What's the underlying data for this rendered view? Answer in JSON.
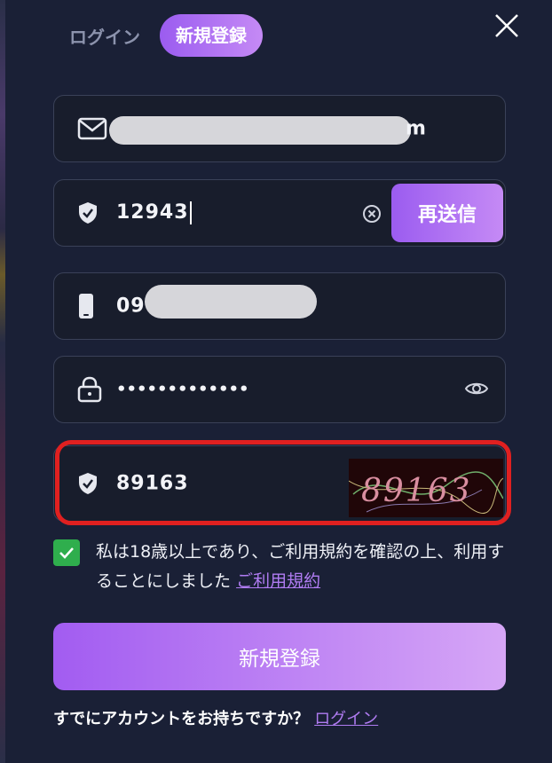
{
  "tabs": {
    "login": "ログイン",
    "register": "新規登録"
  },
  "fields": {
    "email": {
      "value_suffix": "m"
    },
    "code": {
      "value": "12943",
      "resend_label": "再送信"
    },
    "phone": {
      "value_prefix": "09"
    },
    "password": {
      "value": "•••••••••••••"
    },
    "captcha": {
      "value": "89163",
      "image_text": "89163"
    }
  },
  "agreement": {
    "checked": true,
    "text": "私は18歳以上であり、ご利用規約を確認の上、利用することにしました",
    "link": "ご利用規約"
  },
  "submit_label": "新規登録",
  "footer": {
    "question": "すでにアカウントをお持ちですか？",
    "login_link": "ログイン"
  },
  "colors": {
    "accent": "#9b5cf0",
    "highlight": "#e02020",
    "check": "#2fae4d",
    "background": "#1a2036"
  }
}
